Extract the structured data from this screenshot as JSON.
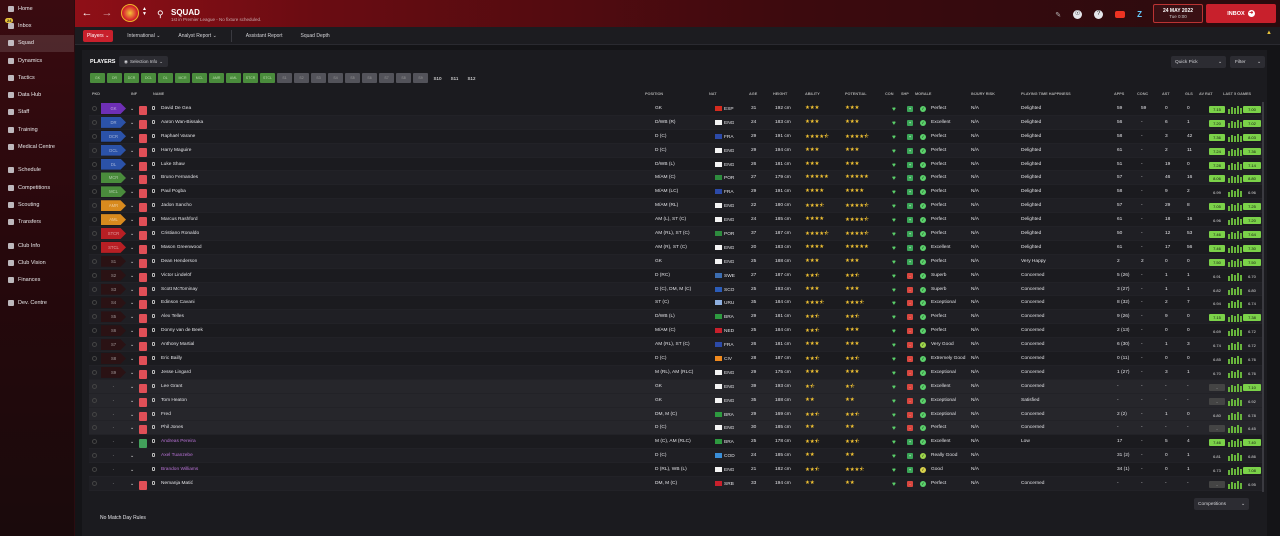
{
  "sidebar": {
    "items": [
      {
        "label": "Home",
        "icon": "home-icon"
      },
      {
        "label": "Inbox",
        "icon": "inbox-icon",
        "badge": "24"
      },
      {
        "label": "Squad",
        "icon": "squad-icon",
        "active": true
      },
      {
        "label": "Dynamics",
        "icon": "dynamics-icon"
      },
      {
        "label": "Tactics",
        "icon": "tactics-icon"
      },
      {
        "label": "Data Hub",
        "icon": "data-hub-icon"
      },
      {
        "label": "Staff",
        "icon": "staff-icon"
      },
      {
        "label": "Training",
        "icon": "training-icon"
      },
      {
        "label": "Medical Centre",
        "icon": "medical-icon"
      },
      {
        "label": "Schedule",
        "icon": "schedule-icon"
      },
      {
        "label": "Competitions",
        "icon": "trophy-icon"
      },
      {
        "label": "Scouting",
        "icon": "scouting-icon"
      },
      {
        "label": "Transfers",
        "icon": "transfers-icon"
      },
      {
        "label": "Club Info",
        "icon": "club-info-icon"
      },
      {
        "label": "Club Vision",
        "icon": "club-vision-icon"
      },
      {
        "label": "Finances",
        "icon": "finances-icon"
      },
      {
        "label": "Dev. Centre",
        "icon": "dev-centre-icon"
      }
    ]
  },
  "header": {
    "title": "SQUAD",
    "subtitle": "1st in Premier League - No fixture scheduled.",
    "date": "24 MAY 2022",
    "time": "Tue 0:00",
    "inbox_label": "INBOX",
    "accent": "#c8202c"
  },
  "subnav": {
    "tabs": [
      "Players",
      "International",
      "Analyst Report",
      "Assistant Report",
      "Squad Depth"
    ]
  },
  "panel": {
    "players_label": "PLAYERS",
    "selection_info": "Selection Info",
    "quick_pick": "Quick Pick",
    "filter": "Filter",
    "competitions": "Competitions",
    "footer": "No Match Day Rules",
    "positions": [
      "GK",
      "DR",
      "DCR",
      "DCL",
      "DL",
      "MCR",
      "MCL",
      "AMR",
      "AML",
      "STCR",
      "STCL",
      "S1",
      "S2",
      "S3",
      "S4",
      "S5",
      "S6",
      "S7",
      "S8",
      "S9",
      "S10",
      "S11",
      "S12"
    ]
  },
  "columns": [
    "PKD",
    "INF",
    "NAME",
    "POSITION",
    "NAT",
    "AGE",
    "HEIGHT",
    "ABILITY",
    "POTENTIAL",
    "CON",
    "SHP",
    "MORALE",
    "INJURY RISK",
    "PLAYING TIME HAPPINESS",
    "APPS",
    "CONC",
    "AST",
    "GLS",
    "AV RAT",
    "LAST 5 GAMES"
  ],
  "players": [
    {
      "pkd": "GK",
      "pkd_color": "#6e2fb5",
      "name": "David De Gea",
      "pos": "GK",
      "nat": "ESP",
      "age": "31",
      "height": "192 cm",
      "ab": 3,
      "pot": 3,
      "morale": "Perfect",
      "inj": "N/A",
      "pth": "Delighted",
      "apps": "59",
      "conc": "59",
      "ast": "0",
      "gls": "0",
      "avr": "7.15",
      "l5": "7.00"
    },
    {
      "pkd": "DR",
      "pkd_color": "#2b52a8",
      "name": "Aaron Wan-Bissaka",
      "pos": "D/WB (R)",
      "nat": "ENG",
      "age": "24",
      "height": "183 cm",
      "ab": 3,
      "pot": 3,
      "morale": "Excellent",
      "inj": "N/A",
      "pth": "Delighted",
      "apps": "56",
      "conc": "-",
      "ast": "6",
      "gls": "1",
      "avr": "7.20",
      "l5": "7.02"
    },
    {
      "pkd": "DCR",
      "pkd_color": "#2b52a8",
      "name": "Raphaël Varane",
      "pos": "D (C)",
      "nat": "FRA",
      "age": "29",
      "height": "191 cm",
      "ab": 4.5,
      "pot": 4.5,
      "morale": "Perfect",
      "inj": "N/A",
      "pth": "Delighted",
      "apps": "58",
      "conc": "-",
      "ast": "3",
      "gls": "42",
      "avr": "7.36",
      "l5": "8.03"
    },
    {
      "pkd": "DCL",
      "pkd_color": "#2b52a8",
      "name": "Harry Maguire",
      "pos": "D (C)",
      "nat": "ENG",
      "age": "29",
      "height": "194 cm",
      "ab": 3,
      "pot": 3,
      "morale": "Perfect",
      "inj": "N/A",
      "pth": "Delighted",
      "apps": "61",
      "conc": "-",
      "ast": "2",
      "gls": "11",
      "avr": "7.24",
      "l5": "7.36"
    },
    {
      "pkd": "DL",
      "pkd_color": "#2b52a8",
      "name": "Luke Shaw",
      "pos": "D/WB (L)",
      "nat": "ENG",
      "age": "26",
      "height": "181 cm",
      "ab": 3,
      "pot": 3,
      "morale": "Perfect",
      "inj": "N/A",
      "pth": "Delighted",
      "apps": "51",
      "conc": "-",
      "ast": "19",
      "gls": "0",
      "avr": "7.28",
      "l5": "7.14"
    },
    {
      "pkd": "MCR",
      "pkd_color": "#4a8c3c",
      "name": "Bruno Fernandes",
      "pos": "M/AM (C)",
      "nat": "POR",
      "age": "27",
      "height": "179 cm",
      "ab": 5,
      "pot": 5,
      "morale": "Perfect",
      "inj": "N/A",
      "pth": "Delighted",
      "apps": "57",
      "conc": "-",
      "ast": "46",
      "gls": "16",
      "avr": "8.06",
      "l5": "8.80"
    },
    {
      "pkd": "MCL",
      "pkd_color": "#4a8c3c",
      "name": "Paul Pogba",
      "pos": "M/AM (LC)",
      "nat": "FRA",
      "age": "29",
      "height": "191 cm",
      "ab": 4,
      "pot": 4,
      "morale": "Perfect",
      "inj": "N/A",
      "pth": "Delighted",
      "apps": "58",
      "conc": "-",
      "ast": "9",
      "gls": "2",
      "avr": "6.99",
      "l5": "6.96"
    },
    {
      "pkd": "AMR",
      "pkd_color": "#d88a1e",
      "name": "Jadon Sancho",
      "pos": "M/AM (RL)",
      "nat": "ENG",
      "age": "22",
      "height": "180 cm",
      "ab": 3.5,
      "pot": 4.5,
      "morale": "Perfect",
      "inj": "N/A",
      "pth": "Delighted",
      "apps": "57",
      "conc": "-",
      "ast": "29",
      "gls": "8",
      "avr": "7.05",
      "l5": "7.25"
    },
    {
      "pkd": "AML",
      "pkd_color": "#d88a1e",
      "name": "Marcus Rashford",
      "pos": "AM (L), ST (C)",
      "nat": "ENG",
      "age": "24",
      "height": "185 cm",
      "ab": 4,
      "pot": 4.5,
      "morale": "Perfect",
      "inj": "N/A",
      "pth": "Delighted",
      "apps": "61",
      "conc": "-",
      "ast": "18",
      "gls": "16",
      "avr": "6.96",
      "l5": "7.20"
    },
    {
      "pkd": "STCR",
      "pkd_color": "#b81f24",
      "name": "Cristiano Ronaldo",
      "pos": "AM (RL), ST (C)",
      "nat": "POR",
      "age": "37",
      "height": "187 cm",
      "ab": 4.5,
      "pot": 4.5,
      "morale": "Perfect",
      "inj": "N/A",
      "pth": "Delighted",
      "apps": "50",
      "conc": "-",
      "ast": "12",
      "gls": "53",
      "avr": "7.46",
      "l5": "7.64"
    },
    {
      "pkd": "STCL",
      "pkd_color": "#b81f24",
      "name": "Mason Greenwood",
      "pos": "AM (R), ST (C)",
      "nat": "ENG",
      "age": "20",
      "height": "183 cm",
      "ab": 4,
      "pot": 5,
      "morale": "Excellent",
      "inj": "N/A",
      "pth": "Delighted",
      "apps": "61",
      "conc": "-",
      "ast": "17",
      "gls": "56",
      "avr": "7.46",
      "l5": "7.30"
    },
    {
      "pkd": "S1",
      "pkd_color": "#2a1214",
      "name": "Dean Henderson",
      "pos": "GK",
      "nat": "ENG",
      "age": "25",
      "height": "188 cm",
      "ab": 3,
      "pot": 3,
      "morale": "Perfect",
      "inj": "N/A",
      "pth": "Very Happy",
      "apps": "2",
      "conc": "2",
      "ast": "0",
      "gls": "0",
      "avr": "7.50",
      "l5": "7.50"
    },
    {
      "pkd": "S2",
      "pkd_color": "#2a1214",
      "name": "Victor Lindelöf",
      "pos": "D (RC)",
      "nat": "SWE",
      "age": "27",
      "height": "187 cm",
      "ab": 2.5,
      "pot": 2.5,
      "morale": "Superb",
      "inj": "N/A",
      "pth": "Concerned",
      "apps": "5 (26)",
      "conc": "-",
      "ast": "1",
      "gls": "1",
      "avr": "6.91",
      "l5": "6.70"
    },
    {
      "pkd": "S3",
      "pkd_color": "#2a1214",
      "name": "Scott McTominay",
      "pos": "D (C), DM, M (C)",
      "nat": "SCO",
      "age": "25",
      "height": "193 cm",
      "ab": 3,
      "pot": 3,
      "morale": "Superb",
      "inj": "N/A",
      "pth": "Concerned",
      "apps": "3 (27)",
      "conc": "-",
      "ast": "1",
      "gls": "1",
      "avr": "6.82",
      "l5": "6.80"
    },
    {
      "pkd": "S4",
      "pkd_color": "#2a1214",
      "name": "Edinson Cavani",
      "pos": "ST (C)",
      "nat": "URU",
      "age": "35",
      "height": "184 cm",
      "ab": 3.5,
      "pot": 3.5,
      "morale": "Exceptional",
      "inj": "N/A",
      "pth": "Concerned",
      "apps": "8 (32)",
      "conc": "-",
      "ast": "2",
      "gls": "7",
      "avr": "6.94",
      "l5": "6.74"
    },
    {
      "pkd": "S5",
      "pkd_color": "#2a1214",
      "name": "Alex Telles",
      "pos": "D/WB (L)",
      "nat": "BRA",
      "age": "29",
      "height": "181 cm",
      "ab": 2.5,
      "pot": 2.5,
      "morale": "Perfect",
      "inj": "N/A",
      "pth": "Concerned",
      "apps": "9 (26)",
      "conc": "-",
      "ast": "9",
      "gls": "0",
      "avr": "7.15",
      "l5": "7.38"
    },
    {
      "pkd": "S6",
      "pkd_color": "#2a1214",
      "name": "Donny van de Beek",
      "pos": "M/AM (C)",
      "nat": "NED",
      "age": "25",
      "height": "184 cm",
      "ab": 2.5,
      "pot": 3,
      "morale": "Perfect",
      "inj": "N/A",
      "pth": "Concerned",
      "apps": "2 (13)",
      "conc": "-",
      "ast": "0",
      "gls": "0",
      "avr": "6.69",
      "l5": "6.72"
    },
    {
      "pkd": "S7",
      "pkd_color": "#2a1214",
      "name": "Anthony Martial",
      "pos": "AM (RL), ST (C)",
      "nat": "FRA",
      "age": "26",
      "height": "181 cm",
      "ab": 3,
      "pot": 3,
      "morale": "Very Good",
      "inj": "N/A",
      "pth": "Concerned",
      "apps": "6 (30)",
      "conc": "-",
      "ast": "1",
      "gls": "3",
      "avr": "6.74",
      "l5": "6.72"
    },
    {
      "pkd": "S8",
      "pkd_color": "#2a1214",
      "name": "Eric Bailly",
      "pos": "D (C)",
      "nat": "CIV",
      "age": "28",
      "height": "187 cm",
      "ab": 2.5,
      "pot": 2.5,
      "morale": "Extremely Good",
      "inj": "N/A",
      "pth": "Concerned",
      "apps": "0 (11)",
      "conc": "-",
      "ast": "0",
      "gls": "0",
      "avr": "6.85",
      "l5": "6.76"
    },
    {
      "pkd": "S9",
      "pkd_color": "#2a1214",
      "name": "Jesse Lingard",
      "pos": "M (RL), AM (RLC)",
      "nat": "ENG",
      "age": "29",
      "height": "175 cm",
      "ab": 3,
      "pot": 3,
      "morale": "Exceptional",
      "inj": "N/A",
      "pth": "Concerned",
      "apps": "1 (27)",
      "conc": "-",
      "ast": "3",
      "gls": "1",
      "avr": "6.70",
      "l5": "6.76"
    },
    {
      "pkd": "-",
      "pkd_color": "transparent",
      "name": "Lee Grant",
      "pos": "GK",
      "nat": "ENG",
      "age": "39",
      "height": "193 cm",
      "ab": 1.5,
      "pot": 1.5,
      "morale": "Excellent",
      "inj": "N/A",
      "pth": "Concerned",
      "apps": "-",
      "conc": "-",
      "ast": "-",
      "gls": "-",
      "avr": "-",
      "l5": "7.10",
      "reserve": true
    },
    {
      "pkd": "-",
      "pkd_color": "transparent",
      "name": "Tom Heaton",
      "pos": "GK",
      "nat": "ENG",
      "age": "35",
      "height": "188 cm",
      "ab": 2,
      "pot": 2,
      "morale": "Exceptional",
      "inj": "N/A",
      "pth": "Satisfied",
      "apps": "-",
      "conc": "-",
      "ast": "-",
      "gls": "-",
      "avr": "-",
      "l5": "6.92",
      "reserve": true
    },
    {
      "pkd": "-",
      "pkd_color": "transparent",
      "name": "Fred",
      "pos": "DM, M (C)",
      "nat": "BRA",
      "age": "29",
      "height": "169 cm",
      "ab": 2.5,
      "pot": 2.5,
      "morale": "Exceptional",
      "inj": "N/A",
      "pth": "Concerned",
      "apps": "2 (2)",
      "conc": "-",
      "ast": "1",
      "gls": "0",
      "avr": "6.80",
      "l5": "6.78",
      "reserve": true
    },
    {
      "pkd": "-",
      "pkd_color": "transparent",
      "name": "Phil Jones",
      "pos": "D (C)",
      "nat": "ENG",
      "age": "30",
      "height": "185 cm",
      "ab": 2,
      "pot": 2,
      "morale": "Perfect",
      "inj": "N/A",
      "pth": "Concerned",
      "apps": "-",
      "conc": "-",
      "ast": "-",
      "gls": "-",
      "avr": "-",
      "l5": "6.45",
      "reserve": true
    },
    {
      "pkd": "-",
      "pkd_color": "transparent",
      "name": "Andreas Pereira",
      "pos": "M (C), AM (RLC)",
      "nat": "BRA",
      "age": "25",
      "height": "178 cm",
      "ab": 2.5,
      "pot": 2.5,
      "morale": "Excellent",
      "inj": "N/A",
      "pth": "Low",
      "apps": "17",
      "conc": "-",
      "ast": "5",
      "gls": "4",
      "avr": "7.46",
      "l5": "7.40",
      "purple": true,
      "inf_green": true
    },
    {
      "pkd": "-",
      "pkd_color": "transparent",
      "name": "Axel Tuanzebe",
      "pos": "D (C)",
      "nat": "COD",
      "age": "24",
      "height": "185 cm",
      "ab": 2,
      "pot": 2,
      "morale": "Really Good",
      "inj": "N/A",
      "pth": "",
      "apps": "31 (2)",
      "conc": "-",
      "ast": "0",
      "gls": "1",
      "avr": "6.81",
      "l5": "6.86",
      "purple": true,
      "no_inf": true
    },
    {
      "pkd": "-",
      "pkd_color": "transparent",
      "name": "Brandon Williams",
      "pos": "D (RL), WB (L)",
      "nat": "ENG",
      "age": "21",
      "height": "182 cm",
      "ab": 2.5,
      "pot": 3.5,
      "morale": "Good",
      "inj": "N/A",
      "pth": "",
      "apps": "34 (1)",
      "conc": "-",
      "ast": "0",
      "gls": "1",
      "avr": "6.73",
      "l5": "7.08",
      "purple": true,
      "no_inf": true
    },
    {
      "pkd": "-",
      "pkd_color": "transparent",
      "name": "Nemanja Matić",
      "pos": "DM, M (C)",
      "nat": "SRB",
      "age": "33",
      "height": "194 cm",
      "ab": 2,
      "pot": 2,
      "morale": "Perfect",
      "inj": "N/A",
      "pth": "Concerned",
      "apps": "-",
      "conc": "-",
      "ast": "-",
      "gls": "-",
      "avr": "-",
      "l5": "6.95"
    }
  ],
  "flag_colors": {
    "ESP": "#d52b1e",
    "ENG": "#f4f4f4",
    "FRA": "#2c4aa8",
    "POR": "#2e8b3e",
    "SWE": "#3c6db0",
    "SCO": "#2b5cb8",
    "URU": "#8fb0e0",
    "BRA": "#2e9a40",
    "NED": "#c8202c",
    "CIV": "#f08a1e",
    "COD": "#3a8ed8",
    "SRB": "#c8202c"
  }
}
